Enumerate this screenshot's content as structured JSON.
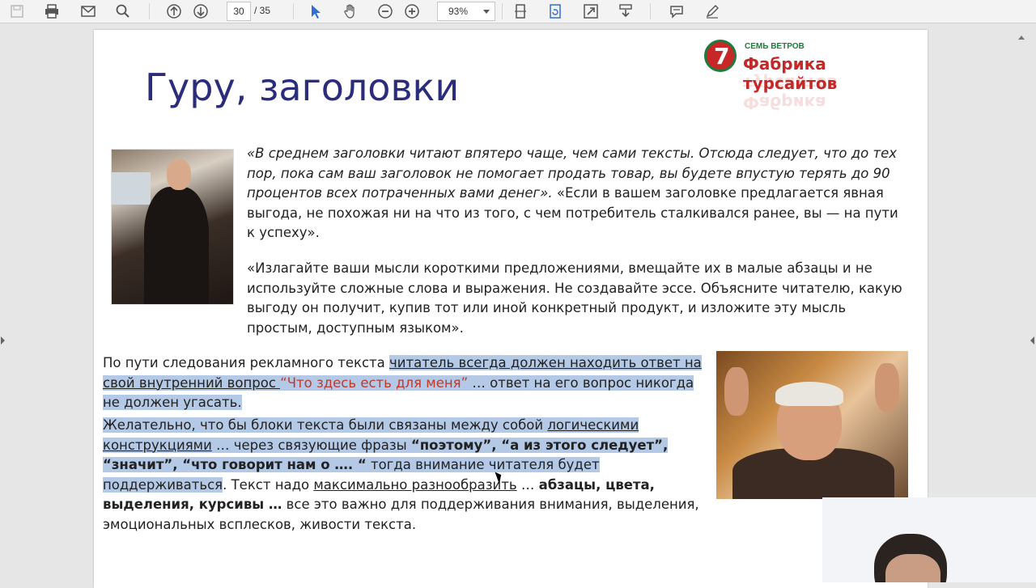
{
  "toolbar": {
    "page_current": "30",
    "page_total": "/ 35",
    "zoom": "93%",
    "icons": [
      "save-icon",
      "print-icon",
      "mail-icon",
      "search-icon",
      "prev-page-icon",
      "next-page-icon",
      "select-tool-icon",
      "hand-tool-icon",
      "zoom-out-icon",
      "zoom-in-icon",
      "fit-page-icon",
      "rotate-icon",
      "fullscreen-icon",
      "read-mode-icon",
      "comment-icon",
      "pen-icon"
    ]
  },
  "slide": {
    "title": "Гуру, заголовки",
    "logo": {
      "small": "СЕМЬ ВЕТРОВ",
      "main": "Фабрика турсайтов",
      "digit": "7"
    },
    "quote1_italic": "«В среднем заголовки читают впятеро чаще, чем сами тексты. Отсюда следует, что до тех пор, пока сам ваш заголовок не помогает продать товар, вы будете впустую терять до 90 процентов всех потраченных вами денег».",
    "quote1_plain": " «Если в вашем заголовке предлагается явная выгода, не похожая ни на что из того, с чем потребитель сталкивался ранее, вы — на пути к успеху».",
    "quote2": "«Излагайте ваши мысли короткими предложениями, вмещайте их в малые абзацы и не используйте сложные слова и выражения. Не создавайте эссе. Объясните читателю, какую выгоду он получит, купив тот или иной конкретный продукт, и изложите эту мысль простым, доступным языком».",
    "para3": {
      "a": "По пути следования рекламного текста ",
      "b": "читатель всегда должен находить ответ на свой внутренний вопрос ",
      "c": "“Что здесь есть для меня”",
      "d": " … ответ на его вопрос никогда не должен угасать."
    },
    "para4": {
      "a": "Желательно, что  бы блоки текста были связаны между собой ",
      "b": "логическими конструкциями",
      "c": " … через связующие фразы ",
      "d": "“поэтому”, “а из этого следует”, “значит”, “что говорит нам о …. “",
      "e": " тогда внимание читателя будет поддерживаться",
      "f": ". Текст надо ",
      "g": "максимально разнообразить",
      "h": " … ",
      "i": "абзацы, цвета, выделения, курсивы …",
      "j": " все это важно для поддерживания внимания, выделения, эмоциональных всплесков, живости текста."
    }
  },
  "colors": {
    "title": "#2b2d7c",
    "highlight": "#b3c9e5",
    "accent_red": "#c0392b"
  }
}
